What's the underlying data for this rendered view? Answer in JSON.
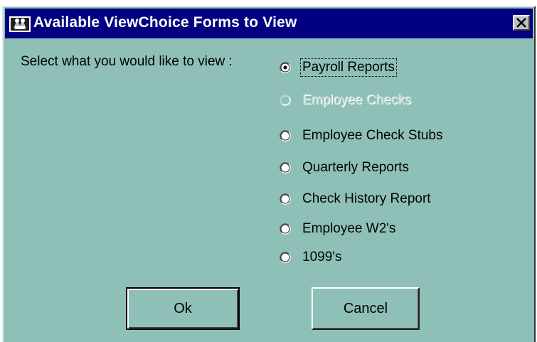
{
  "window": {
    "title": "Available ViewChoice Forms to View",
    "icon": "app-icon",
    "close_icon": "close-icon"
  },
  "prompt": "Select what you would like to view :",
  "options": [
    {
      "label": "Payroll Reports",
      "selected": true,
      "enabled": true
    },
    {
      "label": "Employee Checks",
      "selected": false,
      "enabled": false
    },
    {
      "label": "Employee Check Stubs",
      "selected": false,
      "enabled": true
    },
    {
      "label": "Quarterly Reports",
      "selected": false,
      "enabled": true
    },
    {
      "label": "Check History Report",
      "selected": false,
      "enabled": true
    },
    {
      "label": "Employee W2's",
      "selected": false,
      "enabled": true
    },
    {
      "label": "1099's",
      "selected": false,
      "enabled": true
    }
  ],
  "buttons": {
    "ok_label": "Ok",
    "cancel_label": "Cancel"
  },
  "colors": {
    "titlebar": "#000080",
    "background": "#8fc0b8"
  }
}
